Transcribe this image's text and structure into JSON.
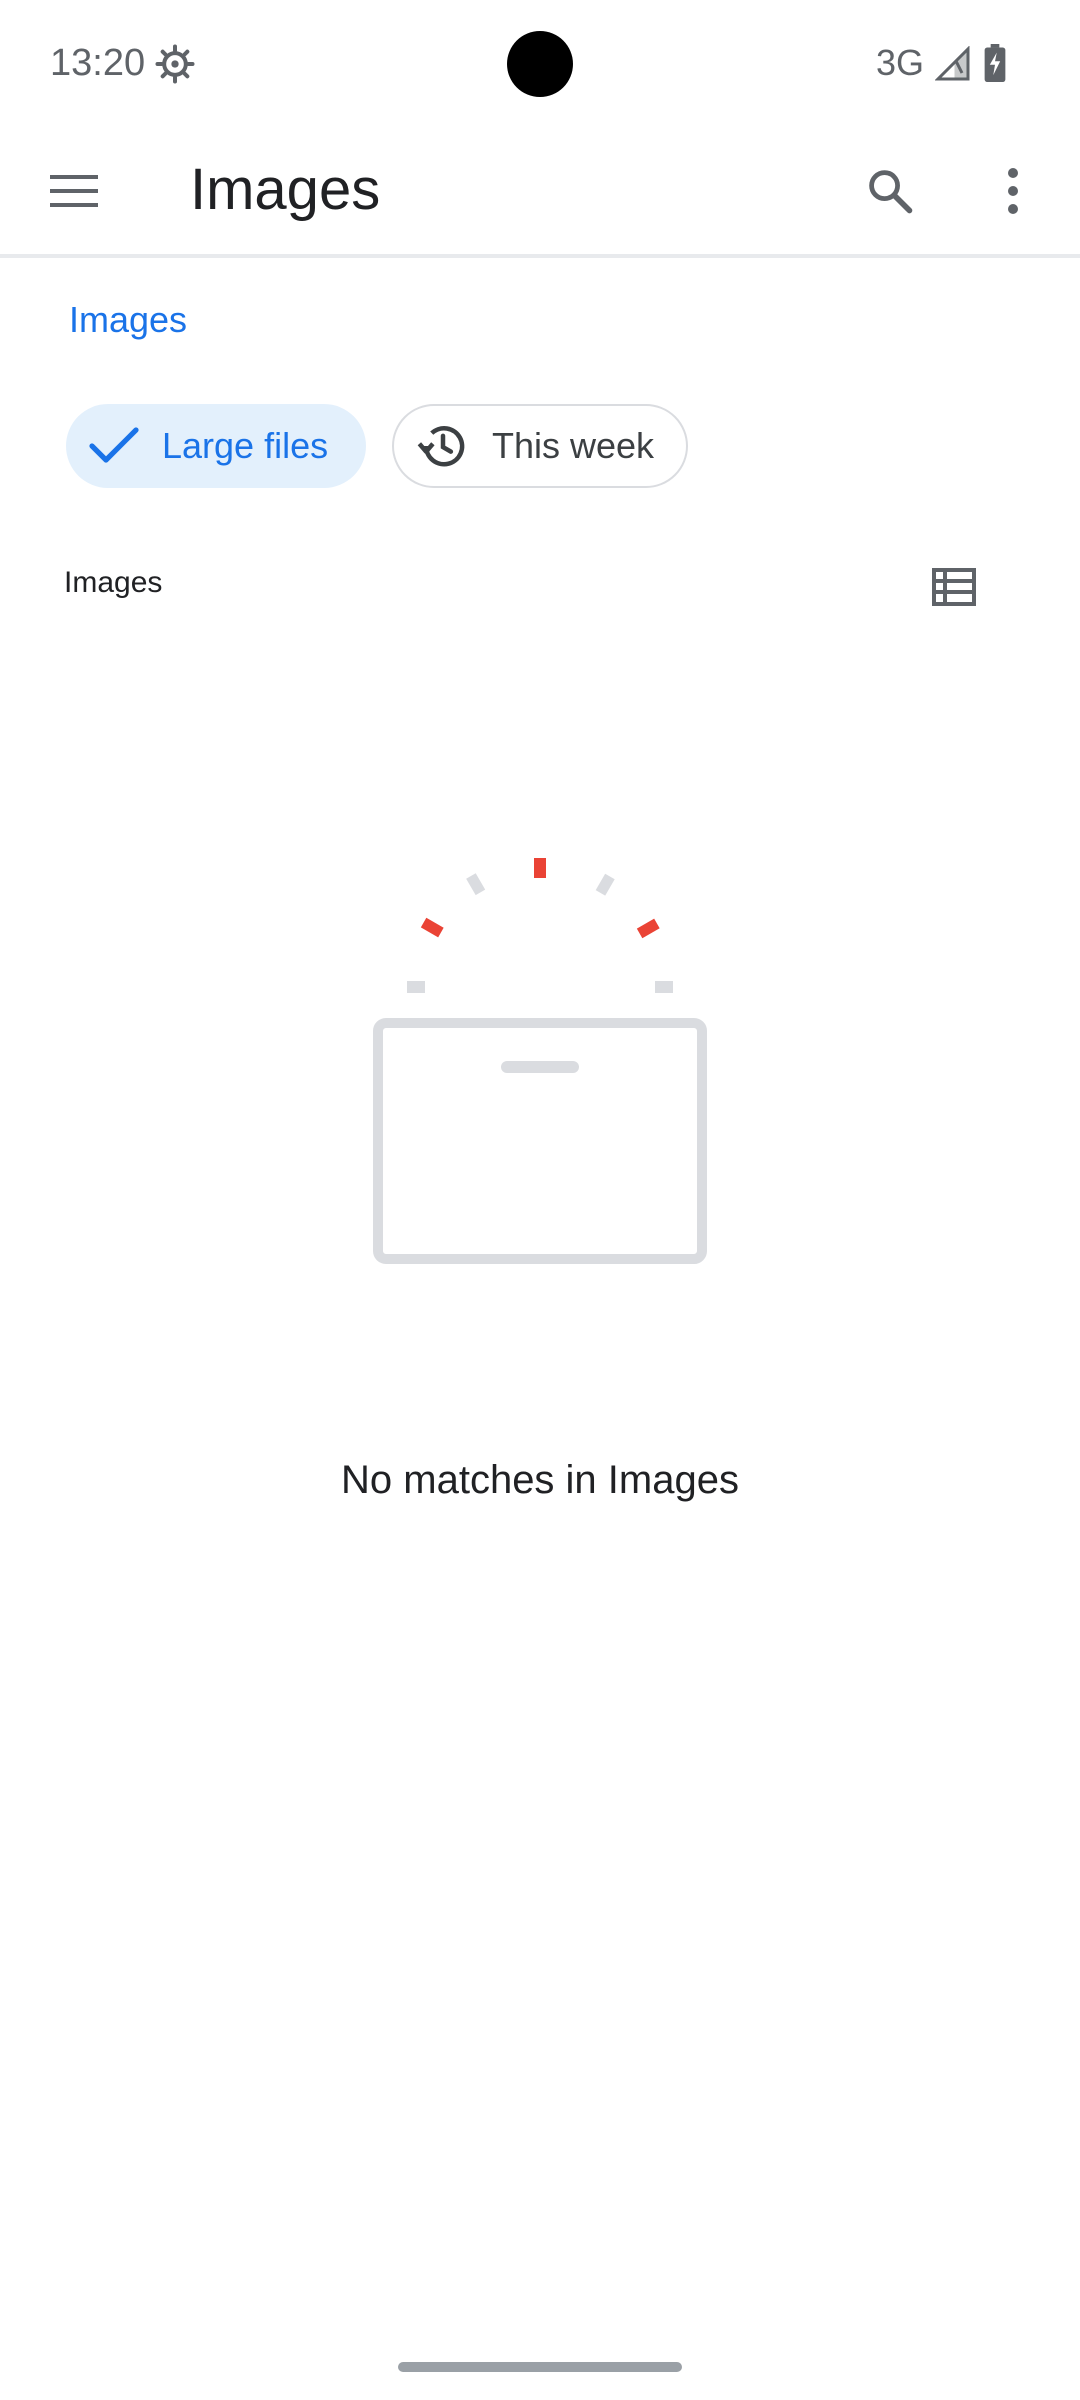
{
  "status_bar": {
    "time": "13:20",
    "network": "3G",
    "icons": [
      "settings-gear-icon",
      "signal-icon",
      "battery-charging-icon"
    ]
  },
  "app_bar": {
    "title": "Images",
    "icons": [
      "menu-icon",
      "search-icon",
      "more-vert-icon"
    ]
  },
  "tabs": [
    {
      "label": "Images",
      "selected": true
    }
  ],
  "chips": [
    {
      "label": "Large files",
      "selected": true,
      "icon": "check-icon"
    },
    {
      "label": "This week",
      "selected": false,
      "icon": "history-icon"
    }
  ],
  "list_header": {
    "label": "Images",
    "view_toggle_icon": "list-view-icon"
  },
  "empty_state": {
    "message": "No matches in Images",
    "icon": "empty-box-icon"
  },
  "colors": {
    "accent": "#1a73e8",
    "chip_selected_bg": "#e3f0fc",
    "empty_accent": "#ea4335",
    "empty_gray": "#dadce0"
  }
}
